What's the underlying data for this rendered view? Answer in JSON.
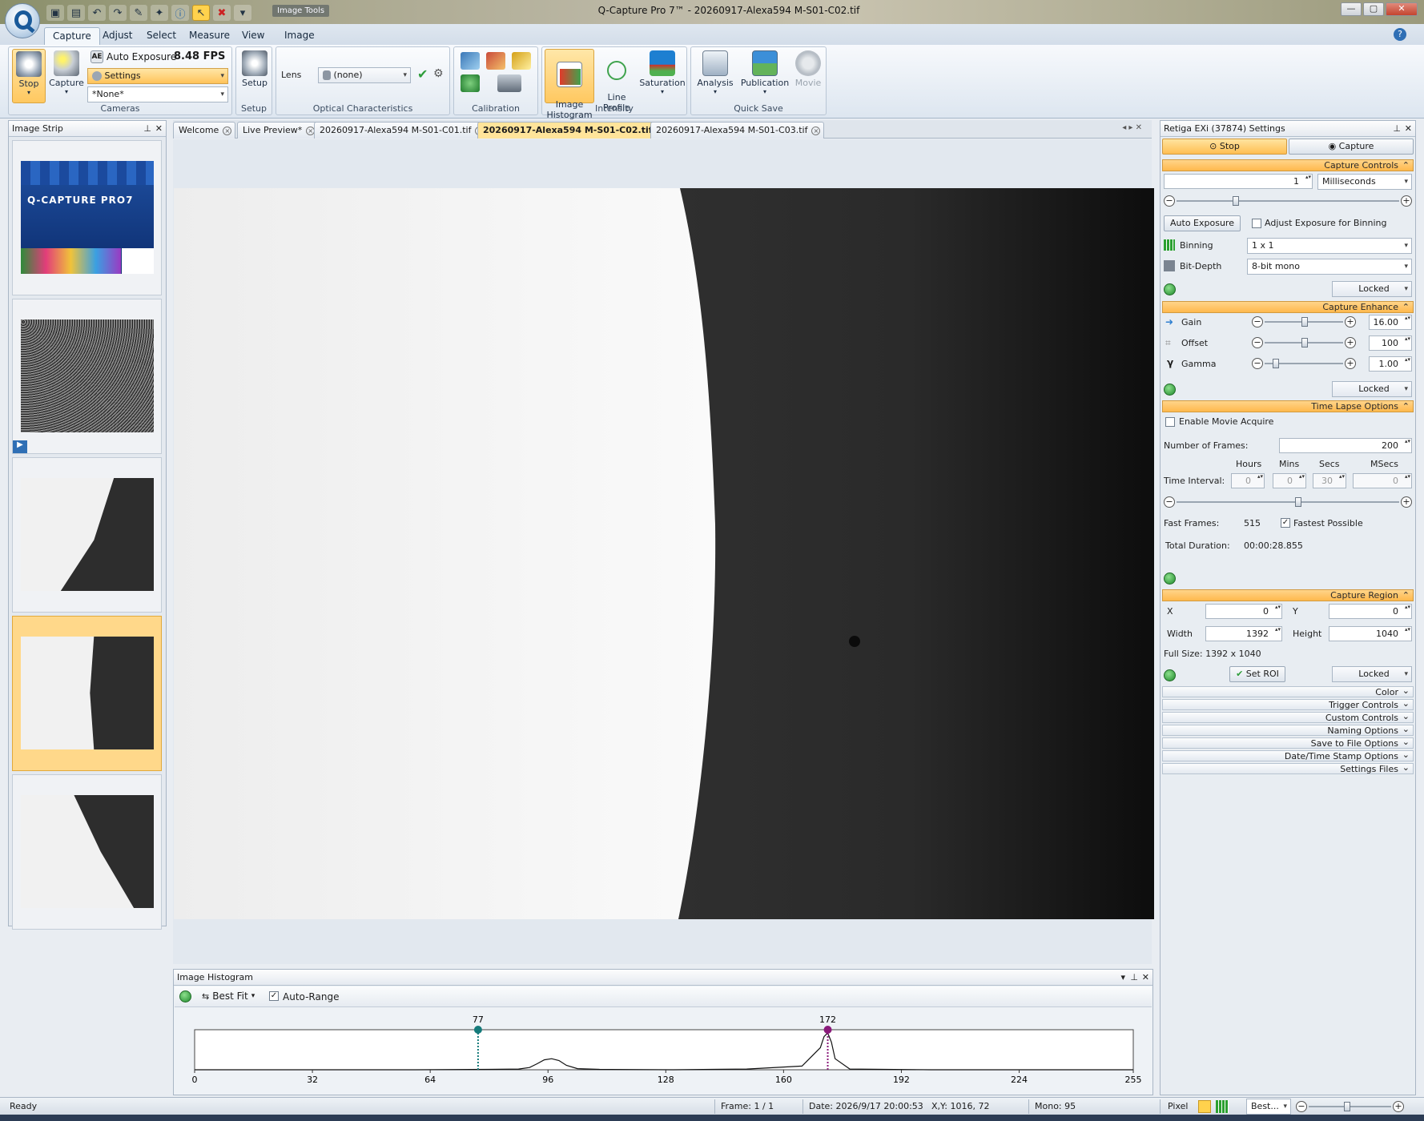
{
  "window": {
    "title": "Q-Capture Pro 7™ - 20260917-Alexa594 M-S01-C02.tif",
    "context_tab": "Image Tools",
    "controls": [
      "—",
      "▢",
      "✕"
    ]
  },
  "quick_access": {
    "icons": [
      "window-icon",
      "save-icon",
      "undo-icon",
      "redo-icon",
      "eyedropper-icon",
      "tools-icon",
      "info-icon",
      "pointer-icon",
      "delete-icon",
      "customize-icon"
    ]
  },
  "ribbon": {
    "tabs": [
      "Capture",
      "Adjust",
      "Select",
      "Measure",
      "View",
      "Image"
    ],
    "cameras": {
      "stop": "Stop",
      "capture": "Capture",
      "auto_exposure": "Auto Exposure",
      "fps": "8.48 FPS",
      "settings": "Settings",
      "preset": "*None*",
      "label": "Cameras"
    },
    "setup": {
      "btn": "Setup",
      "label": "Setup"
    },
    "optical": {
      "lens_label": "Lens",
      "lens_value": "(none)",
      "label": "Optical Characteristics"
    },
    "calibration": {
      "label": "Calibration"
    },
    "intensity": {
      "histogram": "Image\nHistogram",
      "line_profile": "Line\nProfile",
      "saturation": "Saturation",
      "label": "Intensity"
    },
    "quicksave": {
      "analysis": "Analysis",
      "publication": "Publication",
      "movie": "Movie",
      "label": "Quick Save"
    }
  },
  "image_strip": {
    "title": "Image Strip",
    "splash_title": "Q-CAPTURE PRO7"
  },
  "doc_tabs": [
    "Welcome",
    "Live Preview*",
    "20260917-Alexa594 M-S01-C01.tif",
    "20260917-Alexa594 M-S01-C02.tif",
    "20260917-Alexa594 M-S01-C03.tif"
  ],
  "histogram": {
    "title": "Image Histogram",
    "fit": "Best Fit",
    "auto_range": "Auto-Range",
    "low_marker": "77",
    "high_marker": "172",
    "ticks": [
      "0",
      "32",
      "64",
      "96",
      "128",
      "160",
      "192",
      "224",
      "255"
    ]
  },
  "chart_data": {
    "type": "line",
    "title": "Image Histogram",
    "xlim": [
      0,
      255
    ],
    "x": [
      0,
      60,
      80,
      88,
      91,
      93,
      95,
      97,
      99,
      101,
      104,
      110,
      130,
      150,
      165,
      170,
      171,
      172,
      173,
      174,
      178,
      200,
      255
    ],
    "y": [
      0,
      0,
      0.01,
      0.02,
      0.06,
      0.16,
      0.27,
      0.3,
      0.25,
      0.12,
      0.03,
      0.01,
      0,
      0.02,
      0.1,
      0.6,
      0.9,
      1.0,
      0.75,
      0.3,
      0.02,
      0,
      0
    ],
    "markers": {
      "low": 77,
      "high": 172
    }
  },
  "settings": {
    "title": "Retiga EXi (37874) Settings",
    "stop": "Stop",
    "capture": "Capture",
    "capture_controls": "Capture Controls",
    "exposure_value": "1",
    "exposure_unit": "Milliseconds",
    "auto_exposure": "Auto Exposure",
    "adjust_binning": "Adjust Exposure for Binning",
    "binning_label": "Binning",
    "binning_value": "1 x 1",
    "bitdepth_label": "Bit-Depth",
    "bitdepth_value": "8-bit mono",
    "locked": "Locked",
    "capture_enhance": "Capture Enhance",
    "gain_label": "Gain",
    "gain_value": "16.00",
    "offset_label": "Offset",
    "offset_value": "100",
    "gamma_label": "Gamma",
    "gamma_value": "1.00",
    "time_lapse": "Time Lapse Options",
    "enable_movie": "Enable Movie Acquire",
    "frames_label": "Number of  Frames:",
    "frames_value": "200",
    "hours": "Hours",
    "mins": "Mins",
    "secs": "Secs",
    "msecs": "MSecs",
    "interval_label": "Time Interval:",
    "interval_values": [
      "0",
      "0",
      "30",
      "0"
    ],
    "fast_frames_label": "Fast Frames:",
    "fast_frames_value": "515",
    "fastest": "Fastest Possible",
    "total_duration_label": "Total Duration:",
    "total_duration_value": "00:00:28.855",
    "capture_region": "Capture Region",
    "x_label": "X",
    "x_value": "0",
    "y_label": "Y",
    "y_value": "0",
    "width_label": "Width",
    "width_value": "1392",
    "height_label": "Height",
    "height_value": "1040",
    "full_size": "Full Size: 1392 x 1040",
    "set_roi": "Set ROI",
    "collapsed": [
      "Color",
      "Trigger Controls",
      "Custom Controls",
      "Naming Options",
      "Save to File Options",
      "Date/Time Stamp Options",
      "Settings Files"
    ]
  },
  "status": {
    "ready": "Ready",
    "frame": "Frame: 1 / 1",
    "date": "Date: 2026/9/17 20:00:53",
    "xy": "X,Y: 1016,   72",
    "mono": "Mono:   95",
    "pixel": "Pixel",
    "zoom": "Best..."
  }
}
